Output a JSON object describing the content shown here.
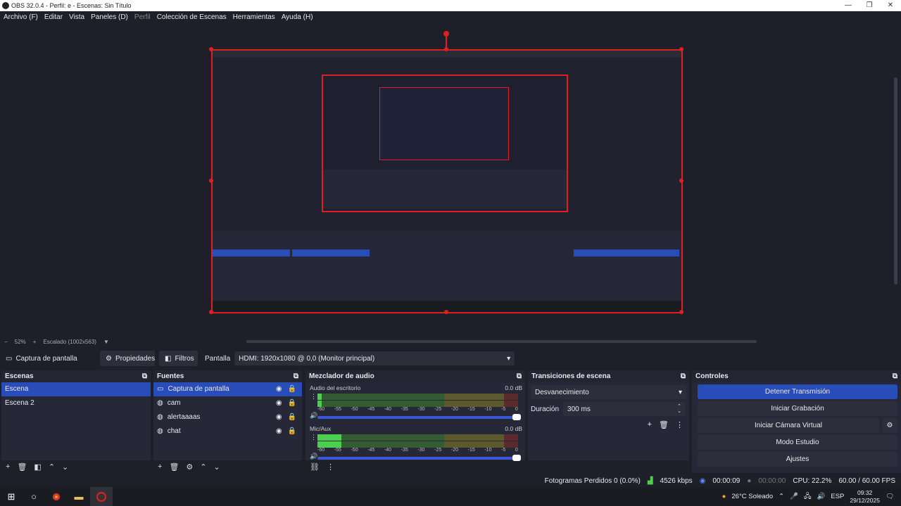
{
  "window": {
    "title": "OBS 32.0.4 - Perfil: e - Escenas: Sin Título",
    "controls": [
      "—",
      "❐",
      "✕"
    ]
  },
  "menu": [
    "Archivo (F)",
    "Editar",
    "Vista",
    "Paneles (D)",
    "Perfil",
    "Colección de Escenas",
    "Herramientas",
    "Ayuda (H)"
  ],
  "zoom": {
    "minus": "−",
    "value": "52%",
    "plus": "+",
    "scaled": "Escalado (1002x563)"
  },
  "toolbar": {
    "source": "Captura de pantalla",
    "properties": "Propiedades",
    "filters": "Filtros",
    "display_label": "Pantalla",
    "display_value": "HDMI: 1920x1080 @ 0,0 (Monitor principal)"
  },
  "scenes": {
    "title": "Escenas",
    "items": [
      "Escena",
      "Escena 2"
    ]
  },
  "sources": {
    "title": "Fuentes",
    "items": [
      "Captura de pantalla",
      "cam",
      "alertaaaas",
      "chat"
    ]
  },
  "mixer": {
    "title": "Mezclador de audio",
    "channels": [
      {
        "name": "Audio del escritorio",
        "db": "0.0 dB",
        "level": 0.02
      },
      {
        "name": "Mic/Aux",
        "db": "0.0 dB",
        "level": 0.12
      }
    ],
    "scale": [
      "-60",
      "-55",
      "-50",
      "-45",
      "-40",
      "-35",
      "-30",
      "-25",
      "-20",
      "-15",
      "-10",
      "-5",
      "0"
    ]
  },
  "transitions": {
    "title": "Transiciones de escena",
    "selected": "Desvanecimiento",
    "duration_label": "Duración",
    "duration_value": "300 ms"
  },
  "controls": {
    "title": "Controles",
    "buttons": [
      "Detener Transmisión",
      "Iniciar Grabación",
      "Iniciar Cámara Virtual",
      "Modo Estudio",
      "Ajustes"
    ]
  },
  "status": {
    "dropped": "Fotogramas Perdidos 0 (0.0%)",
    "bitrate": "4526 kbps",
    "stream_time": "00:00:09",
    "rec_time": "00:00:00",
    "cpu": "CPU: 22.2%",
    "fps": "60.00 / 60.00 FPS"
  },
  "taskbar": {
    "weather": "26°C Soleado",
    "lang": "ESP",
    "time": "09:32",
    "date": "29/12/2025"
  },
  "colors": {
    "accent": "#284cb8",
    "selection": "#e02020"
  }
}
